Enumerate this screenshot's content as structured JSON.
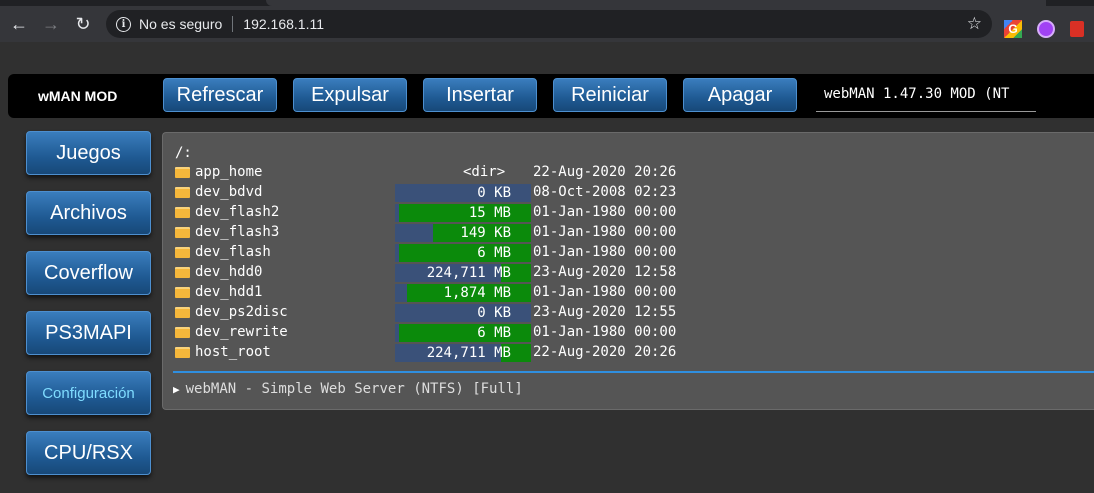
{
  "browser": {
    "security_label": "No es seguro",
    "url": "192.168.1.11",
    "extensions": [
      "google-translate-icon",
      "purple-extension-icon",
      "red-extension-icon"
    ]
  },
  "header": {
    "brand": "wMAN MOD",
    "buttons": [
      "Refrescar",
      "Expulsar",
      "Insertar",
      "Reiniciar",
      "Apagar"
    ],
    "version": "webMAN 1.47.30 MOD (NT"
  },
  "sidebar": {
    "items": [
      "Juegos",
      "Archivos",
      "Coverflow",
      "PS3MAPI",
      "Configuración",
      "CPU/RSX"
    ],
    "active": "Configuración"
  },
  "files": {
    "path": "/:",
    "rows": [
      {
        "name": "app_home",
        "size": "<dir>",
        "date": "22-Aug-2020 20:26",
        "fill": null
      },
      {
        "name": "dev_bdvd",
        "size": "0 KB",
        "date": "08-Oct-2008 02:23",
        "fill": 0
      },
      {
        "name": "dev_flash2",
        "size": "15 MB",
        "date": "01-Jan-1980 00:00",
        "fill": 0.97
      },
      {
        "name": "dev_flash3",
        "size": "149 KB",
        "date": "01-Jan-1980 00:00",
        "fill": 0.72
      },
      {
        "name": "dev_flash",
        "size": "6 MB",
        "date": "01-Jan-1980 00:00",
        "fill": 0.97
      },
      {
        "name": "dev_hdd0",
        "size": "224,711 MB",
        "date": "23-Aug-2020 12:58",
        "fill": 0.22
      },
      {
        "name": "dev_hdd1",
        "size": "1,874 MB",
        "date": "01-Jan-1980 00:00",
        "fill": 0.91
      },
      {
        "name": "dev_ps2disc",
        "size": "0 KB",
        "date": "23-Aug-2020 12:55",
        "fill": 0
      },
      {
        "name": "dev_rewrite",
        "size": "6 MB",
        "date": "01-Jan-1980 00:00",
        "fill": 0.97
      },
      {
        "name": "host_root",
        "size": "224,711 MB",
        "date": "22-Aug-2020 20:26",
        "fill": 0.22
      }
    ],
    "footer": "webMAN - Simple Web Server (NTFS) [Full]"
  },
  "colors": {
    "accent": "#2f8fe0",
    "button": "#1f5a93",
    "bar_bg": "#3a5179",
    "bar_fill": "#0b8a0b"
  }
}
